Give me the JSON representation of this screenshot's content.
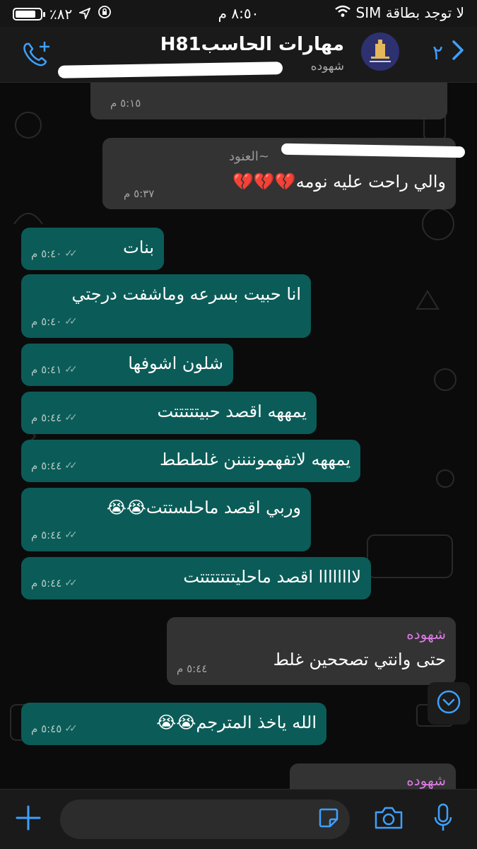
{
  "status_bar": {
    "carrier": "لا توجد بطاقة SIM",
    "time": "٨:٥٠ م",
    "battery": "٪٨٢",
    "battery_level": 0.82
  },
  "header": {
    "back_count": "٢",
    "title": "مهارات الحاسبH81",
    "subtitle": "شهوده"
  },
  "messages": [
    {
      "type": "in",
      "text": "",
      "time": "٥:١٥ م"
    },
    {
      "type": "in",
      "sender": "~العنود",
      "text": "والي راحت عليه نومه💔💔💔",
      "time": "٥:٣٧ م"
    },
    {
      "type": "out",
      "text": "بنات",
      "time": "٥:٤٠ م"
    },
    {
      "type": "out",
      "text": "انا حبيت بسرعه وماشفت درجتي",
      "time": "٥:٤٠ م"
    },
    {
      "type": "out",
      "text": "شلون اشوفها",
      "time": "٥:٤١ م"
    },
    {
      "type": "out",
      "text": "يمههه اقصد حبيتتتتتت",
      "time": "٥:٤٤ م"
    },
    {
      "type": "out",
      "text": "يمههه لاتفهموننننن غلططط",
      "time": "٥:٤٤ م"
    },
    {
      "type": "out",
      "text": "وربي اقصد ماحلستتت😭😭",
      "time": "٥:٤٤ م"
    },
    {
      "type": "out",
      "text": "لاااااااا اقصد ماحليتتتتتتتت",
      "time": "٥:٤٤ م"
    },
    {
      "type": "in",
      "sender": "شهوده",
      "text": "حتى وانتي تصححين غلط",
      "time": "٥:٤٤ م"
    },
    {
      "type": "out",
      "text": "الله ياخذ المترجم😭😭",
      "time": "٥:٤٥ م"
    },
    {
      "type": "in",
      "sender": "شهوده",
      "text": "",
      "time": ""
    }
  ],
  "colors": {
    "outgoing_bubble": "#0b5c58",
    "incoming_bubble": "#333333",
    "accent": "#3ea0ff",
    "sender_name": "#dd7be6"
  },
  "icons": [
    "back-chevron-icon",
    "add-call-icon",
    "plus-icon",
    "sticker-icon",
    "camera-icon",
    "microphone-icon",
    "scroll-down-icon"
  ]
}
